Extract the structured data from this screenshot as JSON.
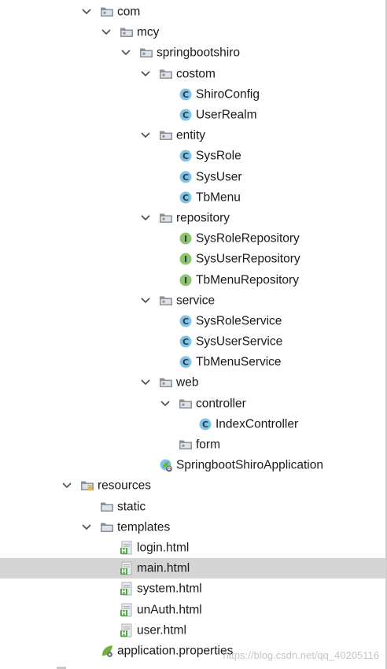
{
  "tree": {
    "nodes": [
      {
        "name": "com",
        "kind": "package",
        "depth": 0,
        "expanded": true
      },
      {
        "name": "mcy",
        "kind": "package",
        "depth": 1,
        "expanded": true
      },
      {
        "name": "springbootshiro",
        "kind": "package",
        "depth": 2,
        "expanded": true
      },
      {
        "name": "costom",
        "kind": "package",
        "depth": 3,
        "expanded": true
      },
      {
        "name": "ShiroConfig",
        "kind": "class",
        "depth": 4
      },
      {
        "name": "UserRealm",
        "kind": "class",
        "depth": 4
      },
      {
        "name": "entity",
        "kind": "package",
        "depth": 3,
        "expanded": true
      },
      {
        "name": "SysRole",
        "kind": "class",
        "depth": 4
      },
      {
        "name": "SysUser",
        "kind": "class",
        "depth": 4
      },
      {
        "name": "TbMenu",
        "kind": "class",
        "depth": 4
      },
      {
        "name": "repository",
        "kind": "package",
        "depth": 3,
        "expanded": true
      },
      {
        "name": "SysRoleRepository",
        "kind": "interface",
        "depth": 4
      },
      {
        "name": "SysUserRepository",
        "kind": "interface",
        "depth": 4
      },
      {
        "name": "TbMenuRepository",
        "kind": "interface",
        "depth": 4
      },
      {
        "name": "service",
        "kind": "package",
        "depth": 3,
        "expanded": true
      },
      {
        "name": "SysRoleService",
        "kind": "class",
        "depth": 4
      },
      {
        "name": "SysUserService",
        "kind": "class",
        "depth": 4
      },
      {
        "name": "TbMenuService",
        "kind": "class",
        "depth": 4
      },
      {
        "name": "web",
        "kind": "package",
        "depth": 3,
        "expanded": true
      },
      {
        "name": "controller",
        "kind": "package",
        "depth": 4,
        "expanded": true
      },
      {
        "name": "IndexController",
        "kind": "class",
        "depth": 5
      },
      {
        "name": "form",
        "kind": "package",
        "depth": 4
      },
      {
        "name": "SpringbootShiroApplication",
        "kind": "spring-app",
        "depth": 3
      },
      {
        "name": "resources",
        "kind": "resources",
        "depth": -1,
        "expanded": true
      },
      {
        "name": "static",
        "kind": "folder",
        "depth": 0
      },
      {
        "name": "templates",
        "kind": "folder",
        "depth": 0,
        "expanded": true
      },
      {
        "name": "login.html",
        "kind": "html",
        "depth": 1
      },
      {
        "name": "main.html",
        "kind": "html",
        "depth": 1,
        "selected": true
      },
      {
        "name": "system.html",
        "kind": "html",
        "depth": 1
      },
      {
        "name": "unAuth.html",
        "kind": "html",
        "depth": 1
      },
      {
        "name": "user.html",
        "kind": "html",
        "depth": 1
      },
      {
        "name": "application.properties",
        "kind": "properties",
        "depth": 0
      }
    ]
  },
  "watermark": "https://blog.csdn.net/qq_40205116",
  "colors": {
    "folder": "#8a9199",
    "class_bg": "#7fc3e6",
    "interface_bg": "#8fc46e",
    "html_green": "#5aa64a",
    "spring_green": "#6db33f",
    "selected_bg": "#d5d5d5"
  },
  "icons": {
    "package": "package-folder-icon",
    "folder": "folder-icon",
    "resources": "resources-folder-icon",
    "class": "class-icon",
    "interface": "interface-icon",
    "html": "html-file-icon",
    "properties": "spring-properties-icon",
    "spring-app": "spring-boot-app-icon",
    "arrow": "chevron-down-icon"
  }
}
